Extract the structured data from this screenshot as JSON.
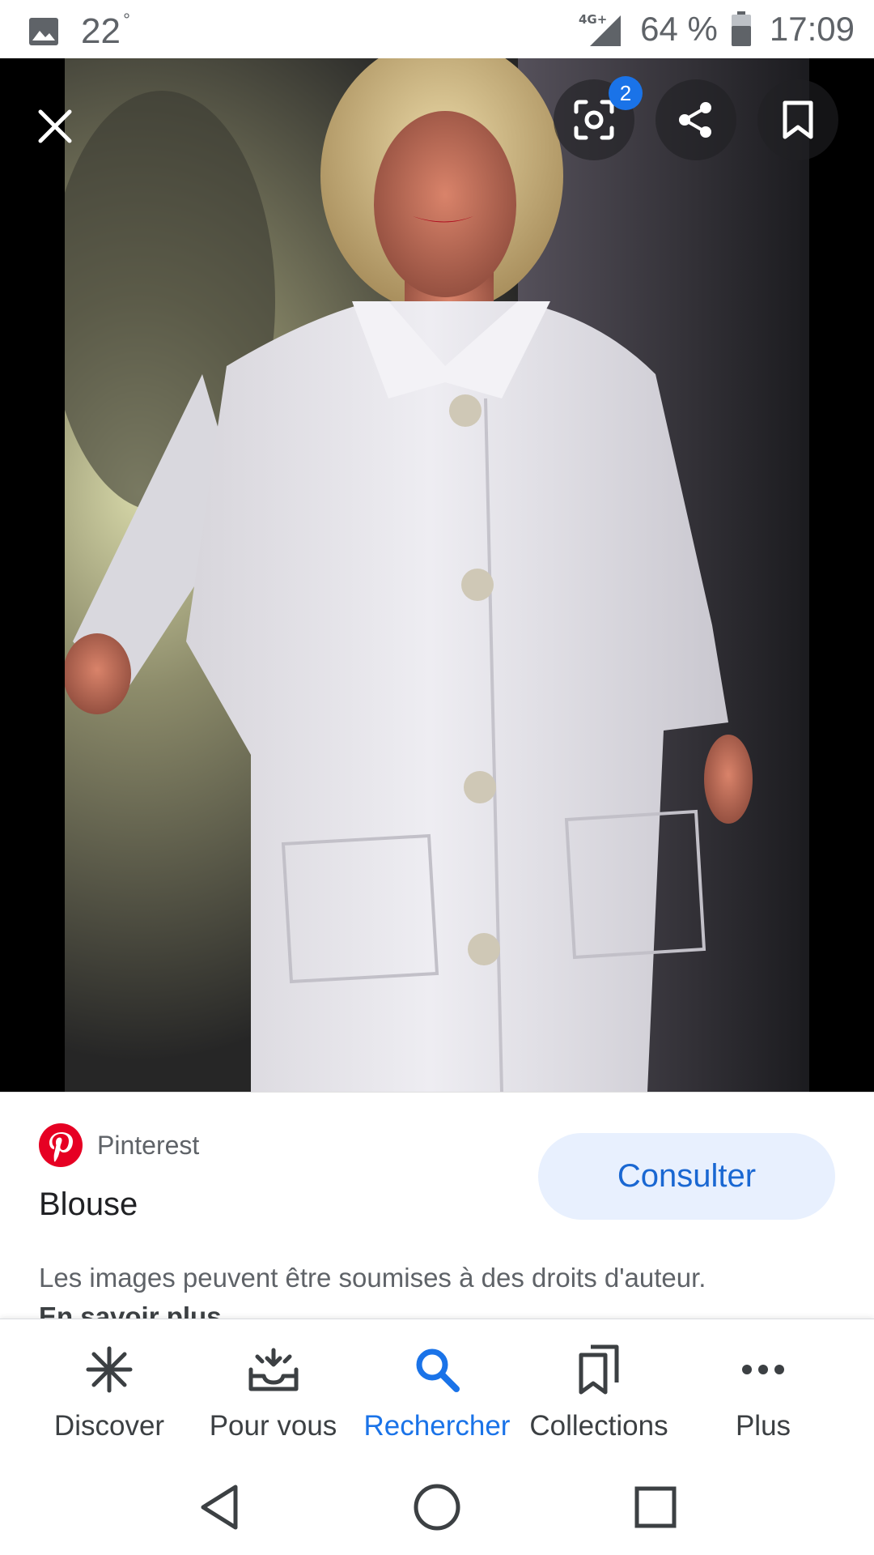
{
  "status_bar": {
    "temperature": "22",
    "degree_symbol": "°",
    "network": "4G+",
    "battery": "64 %",
    "time": "17:09"
  },
  "viewer": {
    "lens_badge_count": "2",
    "icons": [
      "close-icon",
      "lens-icon",
      "share-icon",
      "bookmark-icon"
    ]
  },
  "result": {
    "source": "Pinterest",
    "title": "Blouse",
    "visit_label": "Consulter",
    "copyright_notice": "Les images peuvent être soumises à des droits d'auteur.",
    "learn_more": "En savoir plus"
  },
  "bottom_nav": {
    "items": [
      {
        "label": "Discover",
        "icon": "asterisk-icon",
        "active": false
      },
      {
        "label": "Pour vous",
        "icon": "inbox-icon",
        "active": false
      },
      {
        "label": "Rechercher",
        "icon": "search-icon",
        "active": true
      },
      {
        "label": "Collections",
        "icon": "collections-icon",
        "active": false
      },
      {
        "label": "Plus",
        "icon": "more-icon",
        "active": false
      }
    ]
  },
  "colors": {
    "accent": "#1a73e8",
    "button_bg": "#e8f0fe",
    "pinterest": "#e60023"
  }
}
